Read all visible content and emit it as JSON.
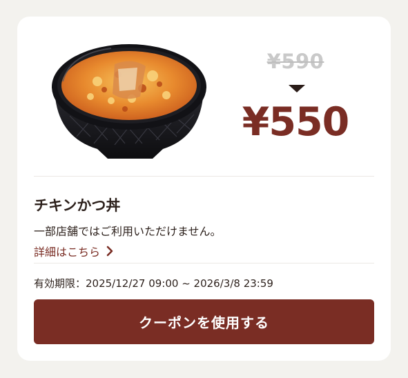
{
  "coupon": {
    "old_price": "¥590",
    "new_price": "¥550",
    "item_name": "チキンかつ丼",
    "note": "一部店舗ではご利用いただけません。",
    "details_link": "詳細はこちら",
    "validity": "有効期限：2025/12/27 09:00 ~ 2026/3/8 23:59",
    "use_button": "クーポンを使用する"
  },
  "colors": {
    "accent": "#7a2d24",
    "background": "#f3f2ee",
    "card": "#ffffff"
  },
  "icons": {
    "arrow": "down-arrow-icon",
    "chevron": "chevron-right-icon",
    "product": "chicken-katsudon-bowl-image"
  }
}
